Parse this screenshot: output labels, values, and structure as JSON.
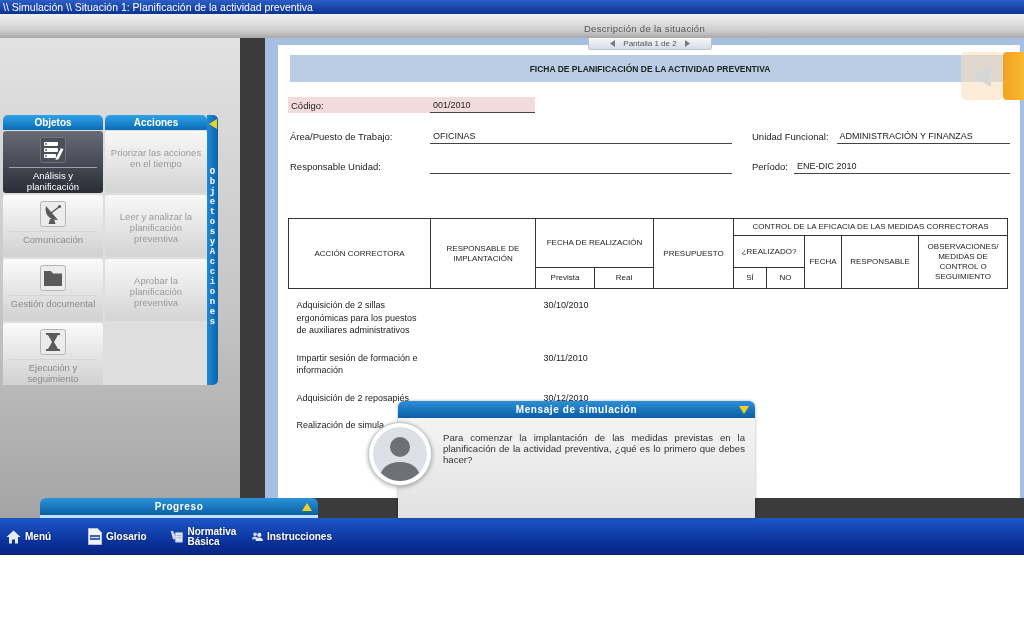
{
  "window": {
    "title": "\\\\ Simulación \\\\ Situación 1: Planificación de la actividad preventiva"
  },
  "header": {
    "title": "Descripción de la situación",
    "pager": "Pantalla 1 de 2"
  },
  "side_panel": {
    "objects_tab": "Objetos",
    "actions_tab": "Acciones",
    "vertical_label": "Objetos y Acciones",
    "objects": [
      {
        "kind": "analysis",
        "label": "Análisis y planificación",
        "selected": true
      },
      {
        "kind": "communication",
        "label": "Comunicación",
        "selected": false
      },
      {
        "kind": "documents",
        "label": "Gestión documental",
        "selected": false
      },
      {
        "kind": "execution",
        "label": "Ejecución y seguimiento",
        "selected": false
      }
    ],
    "actions": [
      {
        "label": "Priorizar las acciones en el tiempo"
      },
      {
        "label": "Leer y analizar la planificación preventiva"
      },
      {
        "label": "Aprobar la planificación preventiva"
      }
    ]
  },
  "document": {
    "title": "FICHA DE PLANIFICACIÓN DE LA ACTIVIDAD PREVENTIVA",
    "code": {
      "label": "Código:",
      "value": "001/2010"
    },
    "rows": [
      {
        "left": {
          "label": "Área/Puesto de Trabajo:",
          "value": "OFICINAS"
        },
        "right": {
          "label": "Unidad Funcional:",
          "value": "ADMINISTRACIÓN Y FINANZAS"
        }
      },
      {
        "left": {
          "label": "Responsable Unidad:"
        },
        "right": {
          "label": "Período:",
          "value": "ENE-DIC 2010"
        }
      }
    ]
  },
  "table": {
    "columns": {
      "action": "ACCIÓN CORRECTORA",
      "responsible": "RESPONSABLE DE IMPLANTACIÓN",
      "date_group": "FECHA DE REALIZACIÓN",
      "planned": "Prevista",
      "actual": "Real",
      "budget": "PRESUPUESTO",
      "control_group": "CONTROL DE LA EFICACIA DE LAS MEDIDAS CORRECTORAS",
      "done": "¿REALIZADO?",
      "yes": "SÍ",
      "no": "NO",
      "date": "FECHA",
      "control_responsible": "RESPONSABLE",
      "observations": "OBSERVACIONES/ MEDIDAS DE CONTROL O SEGUIMIENTO"
    },
    "rows": [
      {
        "action": "Adquisición de 2 sillas ergonómicas para los puestos de auxiliares administrativos",
        "planned": "30/10/2010"
      },
      {
        "action": "Impartir sesión de formación e información",
        "planned": "30/11/2010"
      },
      {
        "action": "Adquisición de 2 reposapiés",
        "planned": "30/12/2010"
      },
      {
        "action": "Realización de simula"
      }
    ]
  },
  "dialog": {
    "title": "Mensaje de simulación",
    "message": "Para comenzar la implantación de las medidas previstas en la planificación de la actividad preventiva, ¿qué es lo primero que debes hacer?"
  },
  "progress": {
    "title": "Progreso"
  },
  "bottom_bar": {
    "items": [
      {
        "kind": "home",
        "label": "Menú"
      },
      {
        "kind": "glossary",
        "label": "Glosario"
      },
      {
        "kind": "regulations",
        "label": "Normativa Básica"
      },
      {
        "kind": "instructions",
        "label": "Instrucciones"
      }
    ]
  }
}
